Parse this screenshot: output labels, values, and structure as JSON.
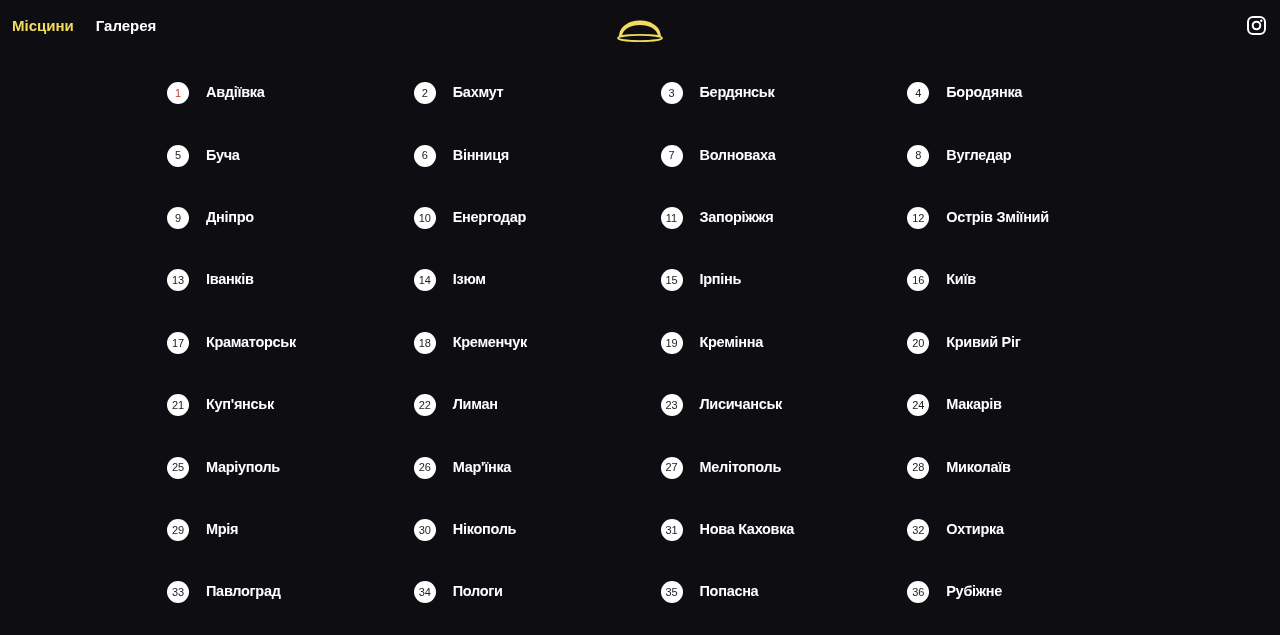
{
  "nav": {
    "links": [
      {
        "label": "Місцини",
        "selected": true
      },
      {
        "label": "Галерея",
        "selected": false
      }
    ]
  },
  "places": [
    {
      "number": "1",
      "name": "Авдіївка",
      "selected": true
    },
    {
      "number": "2",
      "name": "Бахмут",
      "selected": false
    },
    {
      "number": "3",
      "name": "Бердянськ",
      "selected": false
    },
    {
      "number": "4",
      "name": "Бородянка",
      "selected": false
    },
    {
      "number": "5",
      "name": "Буча",
      "selected": false
    },
    {
      "number": "6",
      "name": "Вінниця",
      "selected": false
    },
    {
      "number": "7",
      "name": "Волноваха",
      "selected": false
    },
    {
      "number": "8",
      "name": "Вугледар",
      "selected": false
    },
    {
      "number": "9",
      "name": "Дніпро",
      "selected": false
    },
    {
      "number": "10",
      "name": "Енергодар",
      "selected": false
    },
    {
      "number": "11",
      "name": "Запоріжжя",
      "selected": false
    },
    {
      "number": "12",
      "name": "Острів Зміїний",
      "selected": false
    },
    {
      "number": "13",
      "name": "Іванків",
      "selected": false
    },
    {
      "number": "14",
      "name": "Ізюм",
      "selected": false
    },
    {
      "number": "15",
      "name": "Ірпінь",
      "selected": false
    },
    {
      "number": "16",
      "name": "Київ",
      "selected": false
    },
    {
      "number": "17",
      "name": "Краматорськ",
      "selected": false
    },
    {
      "number": "18",
      "name": "Кременчук",
      "selected": false
    },
    {
      "number": "19",
      "name": "Кремінна",
      "selected": false
    },
    {
      "number": "20",
      "name": "Кривий Ріг",
      "selected": false
    },
    {
      "number": "21",
      "name": "Куп'янськ",
      "selected": false
    },
    {
      "number": "22",
      "name": "Лиман",
      "selected": false
    },
    {
      "number": "23",
      "name": "Лисичанськ",
      "selected": false
    },
    {
      "number": "24",
      "name": "Макарів",
      "selected": false
    },
    {
      "number": "25",
      "name": "Маріуполь",
      "selected": false
    },
    {
      "number": "26",
      "name": "Мар'їнка",
      "selected": false
    },
    {
      "number": "27",
      "name": "Мелітополь",
      "selected": false
    },
    {
      "number": "28",
      "name": "Миколаїв",
      "selected": false
    },
    {
      "number": "29",
      "name": "Мрія",
      "selected": false
    },
    {
      "number": "30",
      "name": "Нікополь",
      "selected": false
    },
    {
      "number": "31",
      "name": "Нова Каховка",
      "selected": false
    },
    {
      "number": "32",
      "name": "Охтирка",
      "selected": false
    },
    {
      "number": "33",
      "name": "Павлоград",
      "selected": false
    },
    {
      "number": "34",
      "name": "Пологи",
      "selected": false
    },
    {
      "number": "35",
      "name": "Попасна",
      "selected": false
    },
    {
      "number": "36",
      "name": "Рубіжне",
      "selected": false
    }
  ]
}
